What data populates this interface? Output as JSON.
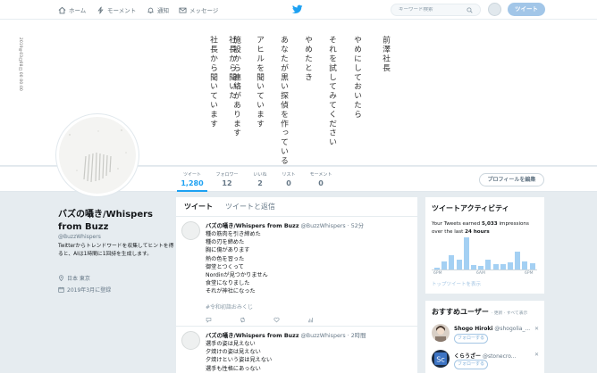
{
  "nav": {
    "home": "ホーム",
    "moments": "モーメント",
    "notifications": "通知",
    "messages": "メッセージ",
    "search_placeholder": "キーワード検索",
    "tweet_button": "ツイート"
  },
  "banner": {
    "date_vertical": "2019年03月08日 00:00:00",
    "poem_lines": [
      "前澤社長",
      "やめにしておいたら",
      "それを試してみてください",
      "やめたとき",
      "あなたが黒い探偵を作っているなら",
      "アヒルを聞いています",
      "施設から連絡があります",
      "社長から聞いた",
      "社長から聞いています"
    ]
  },
  "profile_nav": {
    "stats": [
      {
        "label": "ツイート",
        "value": "1,280"
      },
      {
        "label": "フォロワー",
        "value": "12"
      },
      {
        "label": "いいね",
        "value": "2"
      },
      {
        "label": "リスト",
        "value": "0"
      },
      {
        "label": "モーメント",
        "value": "0"
      }
    ],
    "edit_profile": "プロフィールを編集"
  },
  "profile": {
    "name": "バズの囁き/Whispers from Buzz",
    "handle": "@BuzzWhispers",
    "bio": "Twitterからトレンドワードを収集してヒントを得ると、AIは1時間に1回詩を生成します。",
    "location": "日本 東京",
    "joined": "2019年3月に登録"
  },
  "timeline": {
    "tabs": [
      "ツイート",
      "ツイートと返信"
    ],
    "tweets": [
      {
        "name": "バズの囁き/Whispers from Buzz",
        "handle": "@BuzzWhispers",
        "time": "52分",
        "lines": [
          "種の筋肉を引き締めた",
          "種の刃を締めた",
          "胸に傷があります",
          "熱の色を習った",
          "御堂とつくって",
          "Nordinが見つかりません",
          "食堂になりました",
          "それが神社になった"
        ],
        "hashtag": "#令和初詣おみくじ"
      },
      {
        "name": "バズの囁き/Whispers from Buzz",
        "handle": "@BuzzWhispers",
        "time": "2時間",
        "lines": [
          "選手の姿は見えない",
          "夕焼けの姿は見えない",
          "夕焼けという姿は見えない",
          "選手も性格にあっない"
        ],
        "hashtag": ""
      }
    ]
  },
  "analytics": {
    "title": "ツイートアクティビティ",
    "text_prefix": "Your Tweets earned",
    "impressions": "5,033",
    "text_mid": "impressions over the last",
    "period": "24 hours",
    "axis_left": "6PM",
    "axis_mid": "6AM",
    "axis_right": "6PM",
    "link": "トップツイートを表示",
    "bar_levels": [
      0.05,
      0.25,
      0.45,
      0.3,
      1.0,
      0.15,
      0.12,
      0.3,
      0.18,
      0.18,
      0.22,
      0.55,
      0.25,
      0.2
    ]
  },
  "recommendations": {
    "title": "おすすめユーザー",
    "meta": "· 更新 · すべて表示",
    "users": [
      {
        "name": "Shogo Hiroki",
        "handle": "@shogolia_...",
        "follow": "フォローする"
      },
      {
        "name": "くらうざー",
        "handle": "@stonecro...",
        "follow": "フォローする"
      }
    ]
  },
  "colors": {
    "accent": "#1da1f2",
    "background": "#e6ecf0"
  }
}
